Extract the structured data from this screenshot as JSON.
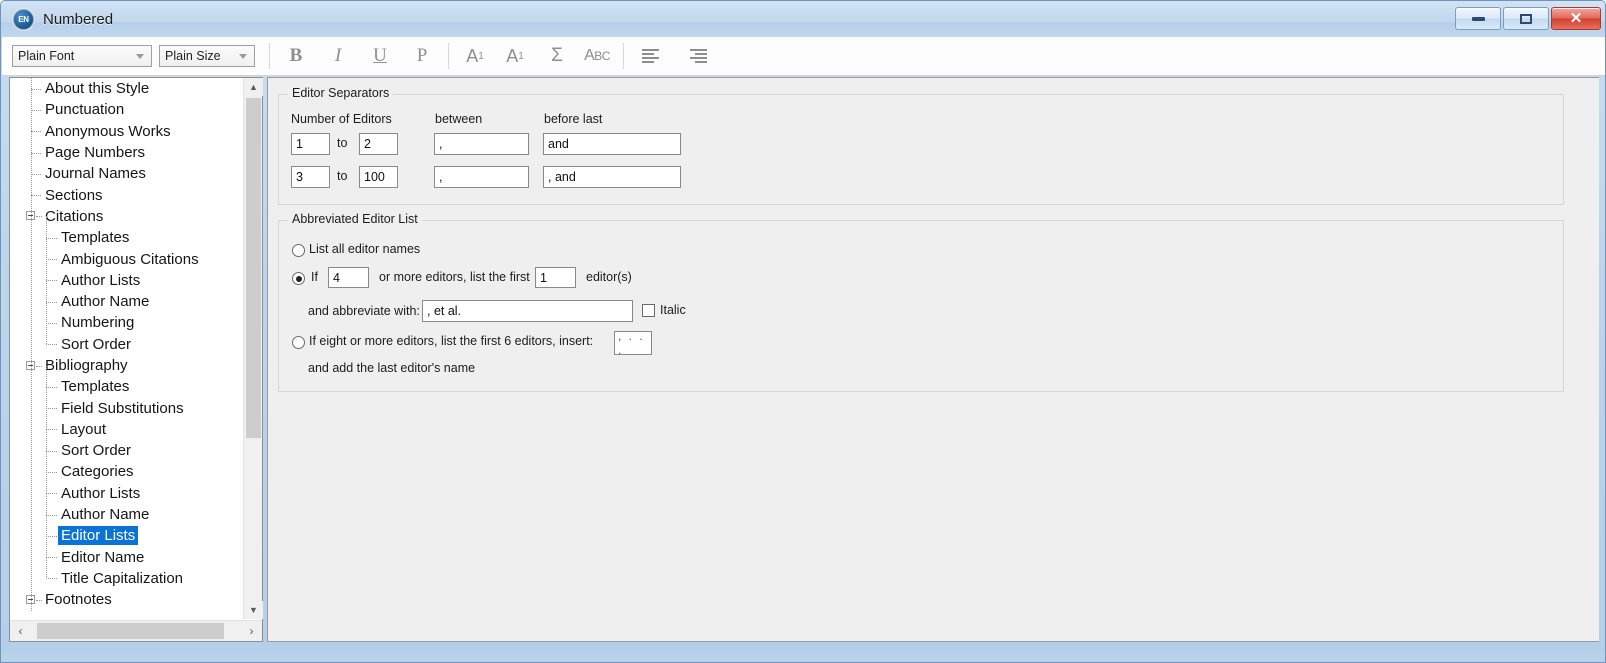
{
  "window": {
    "title": "Numbered",
    "app_icon": "endnote-en-icon",
    "controls": {
      "minimize": "minimize-icon",
      "maximize": "maximize-icon",
      "close": "close-icon"
    }
  },
  "toolbar": {
    "font_combo": {
      "value": "Plain Font",
      "arrow": "chevron-down-icon"
    },
    "size_combo": {
      "value": "Plain Size",
      "arrow": "chevron-down-icon"
    },
    "buttons": [
      {
        "name": "bold-button",
        "label": "B"
      },
      {
        "name": "italic-button",
        "label": "I"
      },
      {
        "name": "underline-button",
        "label": "U"
      },
      {
        "name": "plain-button",
        "label": "P"
      },
      {
        "name": "superscript-button",
        "label": "A1"
      },
      {
        "name": "subscript-button",
        "label": "A1"
      },
      {
        "name": "symbol-button",
        "label": "Σ"
      },
      {
        "name": "spellcheck-button",
        "label": "ABC"
      },
      {
        "name": "align-left-button",
        "label": "align-left-icon"
      },
      {
        "name": "align-right-button",
        "label": "align-right-icon"
      }
    ]
  },
  "sidebar": {
    "scrollbar": {
      "up_arrow": "chevron-up-icon",
      "down_arrow": "chevron-down-icon",
      "left_arrow": "chevron-left-icon",
      "right_arrow": "chevron-right-icon"
    },
    "items": [
      {
        "label": "About this Style",
        "level": 1,
        "expandable": false,
        "selected": false
      },
      {
        "label": "Punctuation",
        "level": 1,
        "expandable": false,
        "selected": false
      },
      {
        "label": "Anonymous Works",
        "level": 1,
        "expandable": false,
        "selected": false
      },
      {
        "label": "Page Numbers",
        "level": 1,
        "expandable": false,
        "selected": false
      },
      {
        "label": "Journal Names",
        "level": 1,
        "expandable": false,
        "selected": false
      },
      {
        "label": "Sections",
        "level": 1,
        "expandable": false,
        "selected": false
      },
      {
        "label": "Citations",
        "level": 0,
        "expandable": true,
        "selected": false
      },
      {
        "label": "Templates",
        "level": 2,
        "expandable": false,
        "selected": false
      },
      {
        "label": "Ambiguous Citations",
        "level": 2,
        "expandable": false,
        "selected": false
      },
      {
        "label": "Author Lists",
        "level": 2,
        "expandable": false,
        "selected": false
      },
      {
        "label": "Author Name",
        "level": 2,
        "expandable": false,
        "selected": false
      },
      {
        "label": "Numbering",
        "level": 2,
        "expandable": false,
        "selected": false
      },
      {
        "label": "Sort Order",
        "level": 2,
        "expandable": false,
        "selected": false
      },
      {
        "label": "Bibliography",
        "level": 0,
        "expandable": true,
        "selected": false
      },
      {
        "label": "Templates",
        "level": 2,
        "expandable": false,
        "selected": false
      },
      {
        "label": "Field Substitutions",
        "level": 2,
        "expandable": false,
        "selected": false
      },
      {
        "label": "Layout",
        "level": 2,
        "expandable": false,
        "selected": false
      },
      {
        "label": "Sort Order",
        "level": 2,
        "expandable": false,
        "selected": false
      },
      {
        "label": "Categories",
        "level": 2,
        "expandable": false,
        "selected": false
      },
      {
        "label": "Author Lists",
        "level": 2,
        "expandable": false,
        "selected": false
      },
      {
        "label": "Author Name",
        "level": 2,
        "expandable": false,
        "selected": false
      },
      {
        "label": "Editor Lists",
        "level": 2,
        "expandable": false,
        "selected": true
      },
      {
        "label": "Editor Name",
        "level": 2,
        "expandable": false,
        "selected": false
      },
      {
        "label": "Title Capitalization",
        "level": 2,
        "expandable": false,
        "selected": false
      },
      {
        "label": "Footnotes",
        "level": 0,
        "expandable": true,
        "selected": false
      }
    ]
  },
  "main": {
    "editor_separators": {
      "legend": "Editor Separators",
      "headers": {
        "number_of_editors": "Number of Editors",
        "between": "between",
        "before_last": "before last"
      },
      "to_label": "to",
      "rows": [
        {
          "from": "1",
          "to": "2",
          "between": ",",
          "before_last": "and"
        },
        {
          "from": "3",
          "to": "100",
          "between": ",",
          "before_last": ", and"
        }
      ]
    },
    "abbreviated_editor_list": {
      "legend": "Abbreviated Editor List",
      "option_all": {
        "label": "List all editor names",
        "selected": false
      },
      "option_if": {
        "selected": true,
        "prefix": "If",
        "threshold": "4",
        "middle": "or more editors, list the first",
        "first_count": "1",
        "suffix": "editor(s)",
        "abbrev_label": "and abbreviate with:",
        "abbrev_value": ", et al.",
        "italic_label": "Italic",
        "italic_checked": false
      },
      "option_eight": {
        "selected": false,
        "label": "If eight or more editors, list the first 6 editors, insert:",
        "insert_value": ", . . .",
        "second_line": "and add the last editor's name"
      }
    }
  },
  "colors": {
    "selection": "#0a74d4",
    "window_frame": "#b9d2ea",
    "panel_bg": "#efefef",
    "close_button": "#d2402f"
  }
}
